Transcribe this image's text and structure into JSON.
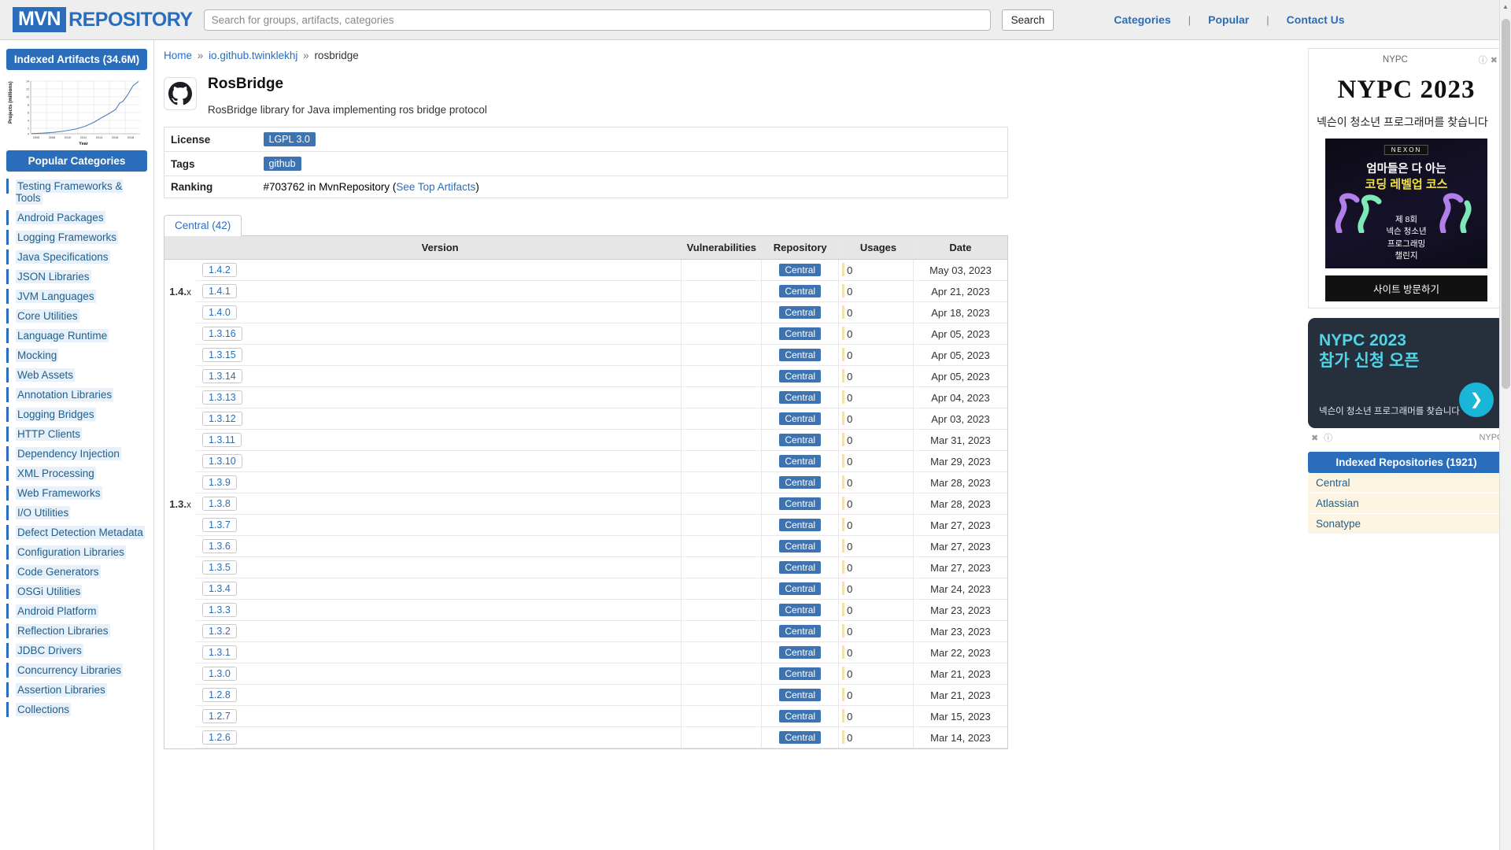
{
  "header": {
    "logo_mvn": "MVN",
    "logo_repository": "REPOSITORY",
    "search_placeholder": "Search for groups, artifacts, categories",
    "search_value": "",
    "search_button": "Search",
    "links": [
      "Categories",
      "Popular",
      "Contact Us"
    ],
    "separator": "|"
  },
  "sidebar": {
    "indexed_artifacts_banner": "Indexed Artifacts (34.6M)",
    "popular_categories_banner": "Popular Categories",
    "categories": [
      "Testing Frameworks & Tools",
      "Android Packages",
      "Logging Frameworks",
      "Java Specifications",
      "JSON Libraries",
      "JVM Languages",
      "Core Utilities",
      "Language Runtime",
      "Mocking",
      "Web Assets",
      "Annotation Libraries",
      "Logging Bridges",
      "HTTP Clients",
      "Dependency Injection",
      "XML Processing",
      "Web Frameworks",
      "I/O Utilities",
      "Defect Detection Metadata",
      "Configuration Libraries",
      "Code Generators",
      "OSGi Utilities",
      "Android Platform",
      "Reflection Libraries",
      "JDBC Drivers",
      "Concurrency Libraries",
      "Assertion Libraries",
      "Collections"
    ]
  },
  "chart_data": {
    "type": "line",
    "title": "Indexed Artifacts (34.6M)",
    "xlabel": "Year",
    "ylabel": "Projects (millions)",
    "x": [
      2005,
      2006,
      2007,
      2008,
      2009,
      2010,
      2011,
      2012,
      2013,
      2014,
      2015,
      2016,
      2017,
      2018,
      2019
    ],
    "values": [
      0.02,
      0.05,
      0.1,
      0.2,
      0.35,
      0.6,
      0.9,
      1.3,
      1.9,
      2.7,
      3.7,
      5.2,
      6.4,
      10.2,
      13.6
    ],
    "xticks": [
      "2006",
      "2008",
      "2010",
      "2012",
      "2014",
      "2016",
      "2018"
    ],
    "yticks": [
      "0",
      "2",
      "4",
      "6",
      "8",
      "10",
      "12",
      "14"
    ],
    "ylim": [
      0,
      14
    ],
    "xlim": [
      2005,
      2019
    ],
    "grid": true,
    "line_color": "#4a7ebb",
    "legend": "none"
  },
  "breadcrumb": {
    "home": "Home",
    "group": "io.github.twinklekhj",
    "artifact": "rosbridge",
    "separator": "»"
  },
  "project": {
    "icon": "github-octocat-icon",
    "title": "RosBridge",
    "description": "RosBridge library for Java implementing ros bridge protocol"
  },
  "meta": {
    "license_key": "License",
    "license_value": "LGPL 3.0",
    "tags_key": "Tags",
    "tags_value": "github",
    "ranking_key": "Ranking",
    "ranking_prefix": "#703762 in MvnRepository (",
    "ranking_link": "See Top Artifacts",
    "ranking_suffix": ")"
  },
  "versions_panel": {
    "tab_label": "Central (42)",
    "columns": [
      "Version",
      "Vulnerabilities",
      "Repository",
      "Usages",
      "Date"
    ],
    "rows": [
      {
        "group": "",
        "version": "1.4.2",
        "vuln": "",
        "repo": "Central",
        "usages": "0",
        "date": "May 03, 2023"
      },
      {
        "group": "1.4.x",
        "version": "1.4.1",
        "vuln": "",
        "repo": "Central",
        "usages": "0",
        "date": "Apr 21, 2023"
      },
      {
        "group": "",
        "version": "1.4.0",
        "vuln": "",
        "repo": "Central",
        "usages": "0",
        "date": "Apr 18, 2023"
      },
      {
        "group": "",
        "version": "1.3.16",
        "vuln": "",
        "repo": "Central",
        "usages": "0",
        "date": "Apr 05, 2023"
      },
      {
        "group": "",
        "version": "1.3.15",
        "vuln": "",
        "repo": "Central",
        "usages": "0",
        "date": "Apr 05, 2023"
      },
      {
        "group": "",
        "version": "1.3.14",
        "vuln": "",
        "repo": "Central",
        "usages": "0",
        "date": "Apr 05, 2023"
      },
      {
        "group": "",
        "version": "1.3.13",
        "vuln": "",
        "repo": "Central",
        "usages": "0",
        "date": "Apr 04, 2023"
      },
      {
        "group": "",
        "version": "1.3.12",
        "vuln": "",
        "repo": "Central",
        "usages": "0",
        "date": "Apr 03, 2023"
      },
      {
        "group": "",
        "version": "1.3.11",
        "vuln": "",
        "repo": "Central",
        "usages": "0",
        "date": "Mar 31, 2023"
      },
      {
        "group": "",
        "version": "1.3.10",
        "vuln": "",
        "repo": "Central",
        "usages": "0",
        "date": "Mar 29, 2023"
      },
      {
        "group": "",
        "version": "1.3.9",
        "vuln": "",
        "repo": "Central",
        "usages": "0",
        "date": "Mar 28, 2023"
      },
      {
        "group": "1.3.x",
        "version": "1.3.8",
        "vuln": "",
        "repo": "Central",
        "usages": "0",
        "date": "Mar 28, 2023"
      },
      {
        "group": "",
        "version": "1.3.7",
        "vuln": "",
        "repo": "Central",
        "usages": "0",
        "date": "Mar 27, 2023"
      },
      {
        "group": "",
        "version": "1.3.6",
        "vuln": "",
        "repo": "Central",
        "usages": "0",
        "date": "Mar 27, 2023"
      },
      {
        "group": "",
        "version": "1.3.5",
        "vuln": "",
        "repo": "Central",
        "usages": "0",
        "date": "Mar 27, 2023"
      },
      {
        "group": "",
        "version": "1.3.4",
        "vuln": "",
        "repo": "Central",
        "usages": "0",
        "date": "Mar 24, 2023"
      },
      {
        "group": "",
        "version": "1.3.3",
        "vuln": "",
        "repo": "Central",
        "usages": "0",
        "date": "Mar 23, 2023"
      },
      {
        "group": "",
        "version": "1.3.2",
        "vuln": "",
        "repo": "Central",
        "usages": "0",
        "date": "Mar 23, 2023"
      },
      {
        "group": "",
        "version": "1.3.1",
        "vuln": "",
        "repo": "Central",
        "usages": "0",
        "date": "Mar 22, 2023"
      },
      {
        "group": "",
        "version": "1.3.0",
        "vuln": "",
        "repo": "Central",
        "usages": "0",
        "date": "Mar 21, 2023"
      },
      {
        "group": "",
        "version": "1.2.8",
        "vuln": "",
        "repo": "Central",
        "usages": "0",
        "date": "Mar 21, 2023"
      },
      {
        "group": "",
        "version": "1.2.7",
        "vuln": "",
        "repo": "Central",
        "usages": "0",
        "date": "Mar 15, 2023"
      },
      {
        "group": "",
        "version": "1.2.6",
        "vuln": "",
        "repo": "Central",
        "usages": "0",
        "date": "Mar 14, 2023"
      }
    ]
  },
  "ads": {
    "ad1": {
      "label": "NYPC",
      "info_icon": "info-icon",
      "close_icon": "close-icon",
      "hero_title": "NYPC 2023",
      "korean_text": "넥슨이 청소년 프로그래머를 찾습니다",
      "brand": "NEXON",
      "image_line1": "엄마들은 다 아는",
      "image_line2": "코딩 레벨업 코스",
      "image_line3": "제 8회\n넥슨 청소년\n프로그래밍\n챌린지",
      "cta": "사이트 방문하기"
    },
    "ad2": {
      "title_line1": "NYPC 2023",
      "title_line2": "참가 신청 오픈",
      "subtitle": "넥슨이 청소년 프로그래머를 찾습니다",
      "arrow_icon": "chevron-right-icon",
      "close_icon": "close-icon",
      "info_icon": "info-icon",
      "advertiser": "NYPC"
    }
  },
  "repositories": {
    "banner": "Indexed Repositories (1921)",
    "items": [
      "Central",
      "Atlassian",
      "Sonatype"
    ]
  }
}
